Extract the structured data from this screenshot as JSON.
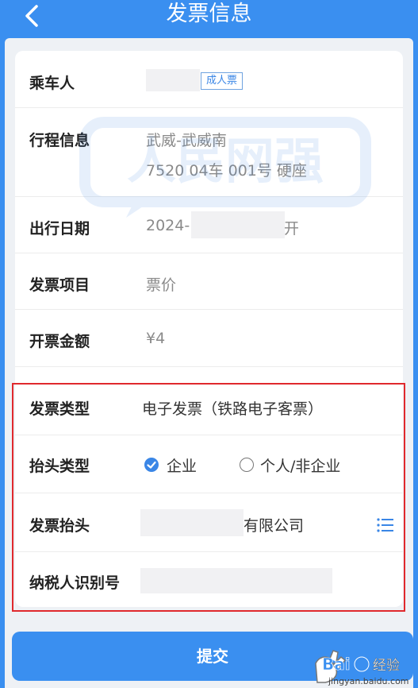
{
  "header": {
    "title": "发票信息"
  },
  "rows": {
    "passenger": {
      "label": "乘车人",
      "badge": "成人票"
    },
    "trip": {
      "label": "行程信息",
      "route": "武威-武威南",
      "train": "7520 04车 001号 硬座"
    },
    "date": {
      "label": "出行日期",
      "year": "2024-",
      "suffix": "开"
    },
    "item": {
      "label": "发票项目",
      "value": "票价"
    },
    "amount": {
      "label": "开票金额",
      "value": "¥4"
    },
    "invoice_type": {
      "label": "发票类型",
      "value": "电子发票（铁路电子客票）"
    },
    "title_type": {
      "label": "抬头类型",
      "option_company": "企业",
      "option_personal": "个人/非企业",
      "selected": "企业"
    },
    "invoice_title": {
      "label": "发票抬头",
      "suffix": "有限公司"
    },
    "tax_id": {
      "label": "纳税人识别号"
    }
  },
  "submit": {
    "label": "提交"
  },
  "watermark_text": "人民网强",
  "baidu": {
    "brand": "Bai",
    "service": "经验",
    "url": "jingyan.baidu.com"
  },
  "colors": {
    "primary": "#3a8ff0",
    "badge": "#3a86e6",
    "highlight": "#e0292d"
  }
}
